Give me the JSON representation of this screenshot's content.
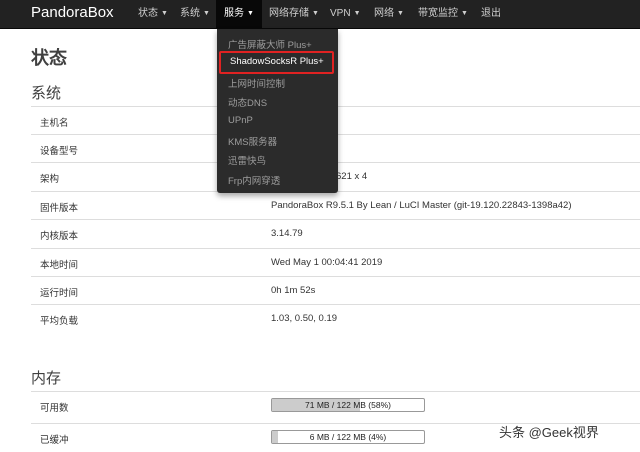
{
  "navbar": {
    "brand": "PandoraBox",
    "items": [
      {
        "label": "状态",
        "has_menu": true
      },
      {
        "label": "系统",
        "has_menu": true
      },
      {
        "label": "服务",
        "has_menu": true
      },
      {
        "label": "网络存储",
        "has_menu": true
      },
      {
        "label": "VPN",
        "has_menu": true
      },
      {
        "label": "网络",
        "has_menu": true
      },
      {
        "label": "带宽监控",
        "has_menu": true
      },
      {
        "label": "退出",
        "has_menu": false
      }
    ],
    "caret": "▼",
    "active": "服务"
  },
  "services_menu": {
    "items": [
      "广告屏蔽大师 Plus+",
      "ShadowSocksR Plus+",
      "上网时间控制",
      "动态DNS",
      "UPnP",
      "KMS服务器",
      "迅雷快鸟",
      "Frp内网穿透"
    ],
    "highlighted": "ShadowSocksR Plus+",
    "highlight_color": "#e02222"
  },
  "page": {
    "title": "状态",
    "system_section": "系统",
    "memory_section": "内存"
  },
  "system": [
    {
      "label": "主机名",
      "value": ""
    },
    {
      "label": "设备型号",
      "value": ""
    },
    {
      "label": "架构",
      "value": "621 x 4"
    },
    {
      "label": "固件版本",
      "value": "PandoraBox R9.5.1 By Lean / LuCI Master (git-19.120.22843-1398a42)"
    },
    {
      "label": "内核版本",
      "value": "3.14.79"
    },
    {
      "label": "本地时间",
      "value": "Wed May 1 00:04:41 2019"
    },
    {
      "label": "运行时间",
      "value": "0h 1m 52s"
    },
    {
      "label": "平均负载",
      "value": "1.03, 0.50, 0.19"
    }
  ],
  "memory": [
    {
      "label": "可用数",
      "bar_text": "71 MB / 122 MB (58%)",
      "percent": 58
    },
    {
      "label": "已缓冲",
      "bar_text": "6 MB / 122 MB (4%)",
      "percent": 4
    }
  ],
  "watermark": "头条 @Geek视界",
  "colors": {
    "navbar_bg": "#222222",
    "dropdown_bg": "#2b2b2b",
    "bar_fill": "#cccccc"
  }
}
